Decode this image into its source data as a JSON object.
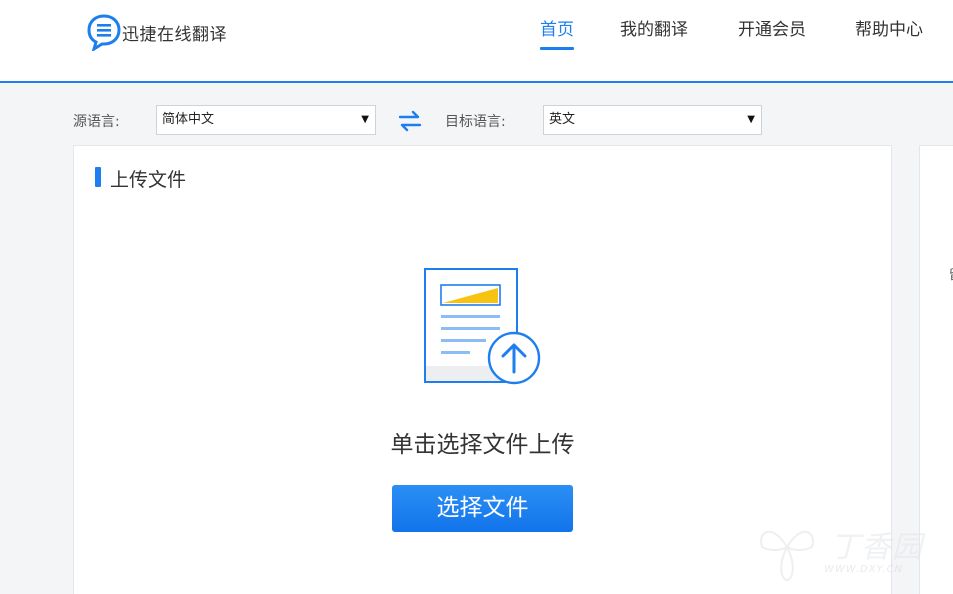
{
  "header": {
    "logo_text": "迅捷在线翻译",
    "nav": [
      {
        "label": "首页",
        "active": true
      },
      {
        "label": "我的翻译",
        "active": false
      },
      {
        "label": "开通会员",
        "active": false
      },
      {
        "label": "帮助中心",
        "active": false
      }
    ]
  },
  "lang_bar": {
    "source_label": "源语言:",
    "source_value": "简体中文",
    "target_label": "目标语言:",
    "target_value": "英文",
    "dropdown_arrow": "▼"
  },
  "upload_panel": {
    "title": "上传文件",
    "prompt": "单击选择文件上传",
    "button_label": "选择文件"
  },
  "right_panel": {
    "fragment": "留"
  },
  "watermark": {
    "text_cn": "丁香园",
    "text_en": "WWW.DXY.CN"
  },
  "colors": {
    "accent": "#1d7ef0",
    "illustration_yellow": "#f7c312",
    "illustration_line": "#8cbcf5"
  },
  "icons": {
    "logo": "chat-bubble-list-icon",
    "swap": "swap-arrows-icon",
    "upload": "document-upload-icon"
  }
}
